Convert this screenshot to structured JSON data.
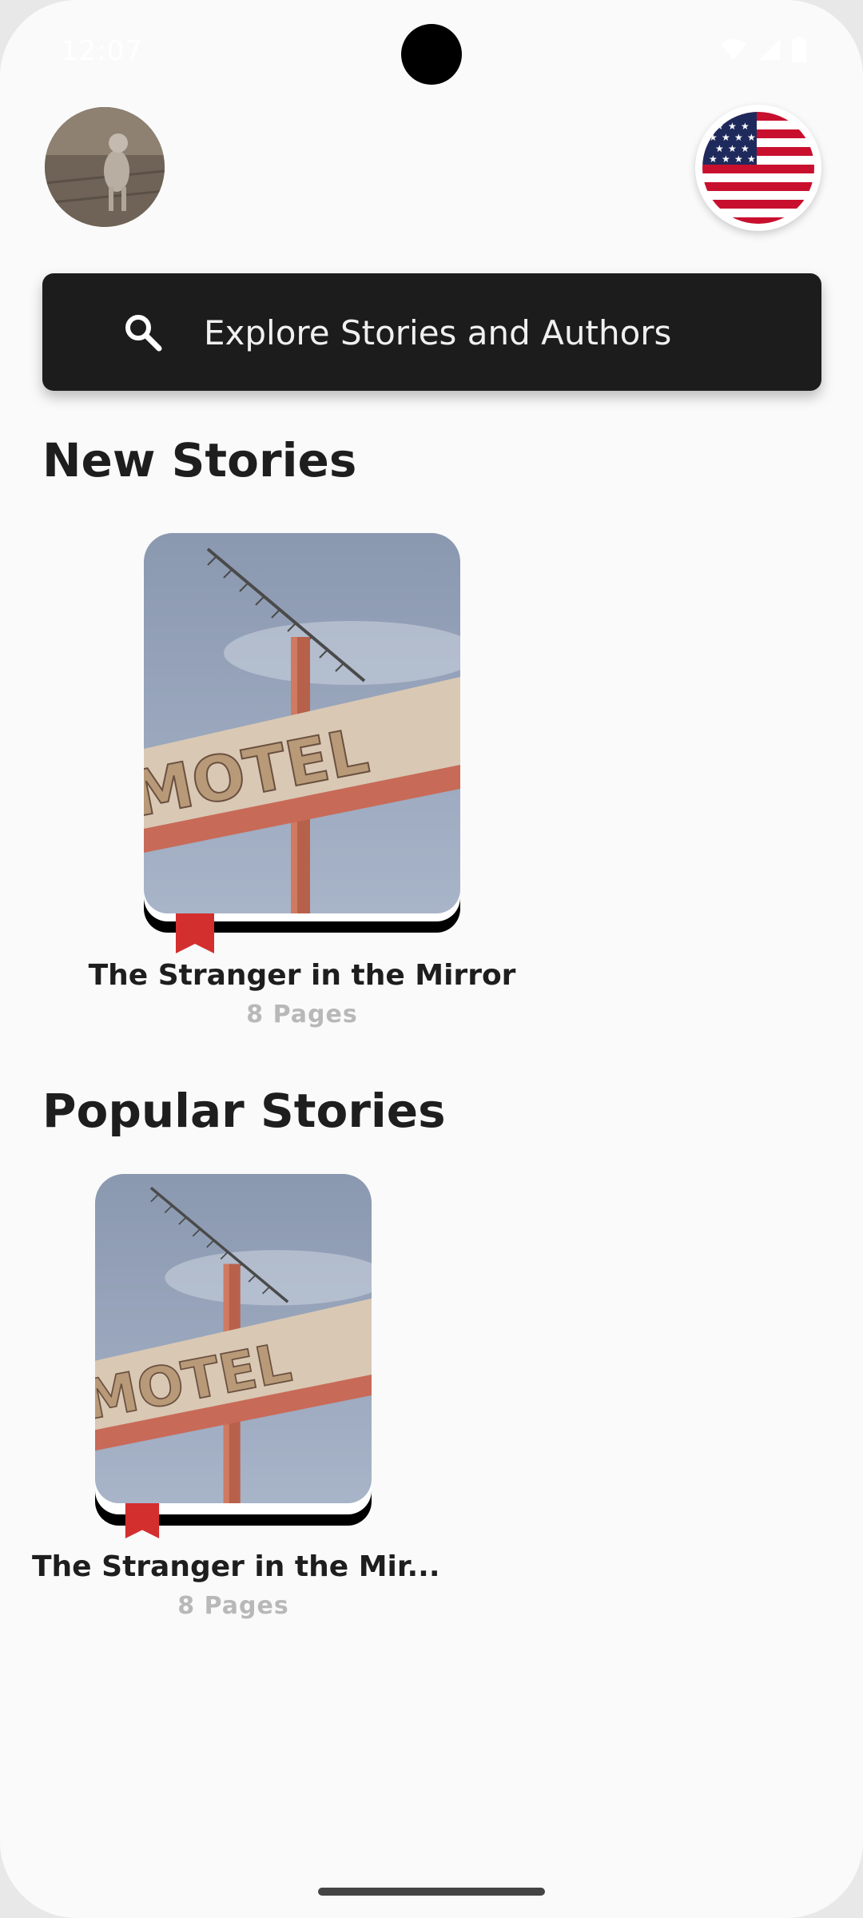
{
  "status_bar": {
    "time": "12:07",
    "icons": [
      "wifi-icon",
      "cellular-signal-icon",
      "battery-icon"
    ]
  },
  "header": {
    "avatar": "profile-avatar-dog-photo",
    "language_flag": "us-flag-icon"
  },
  "search": {
    "placeholder": "Explore Stories and Authors",
    "icon": "search-icon"
  },
  "sections": {
    "new": {
      "title": "New Stories",
      "books": [
        {
          "title": "The Stranger in the Mirror",
          "pages": "8 Pages",
          "cover": "motel-sign-photo"
        }
      ]
    },
    "popular": {
      "title": "Popular Stories",
      "books": [
        {
          "title": "The Stranger in the Mir...",
          "pages": "8 Pages",
          "cover": "motel-sign-photo"
        }
      ]
    }
  },
  "cover_text": "MOTEL",
  "colors": {
    "background": "#fafafa",
    "search_bar": "#1c1c1c",
    "bookmark": "#d32f2f",
    "page_count": "#b8b8b8",
    "title_text": "#1e1e1e"
  }
}
